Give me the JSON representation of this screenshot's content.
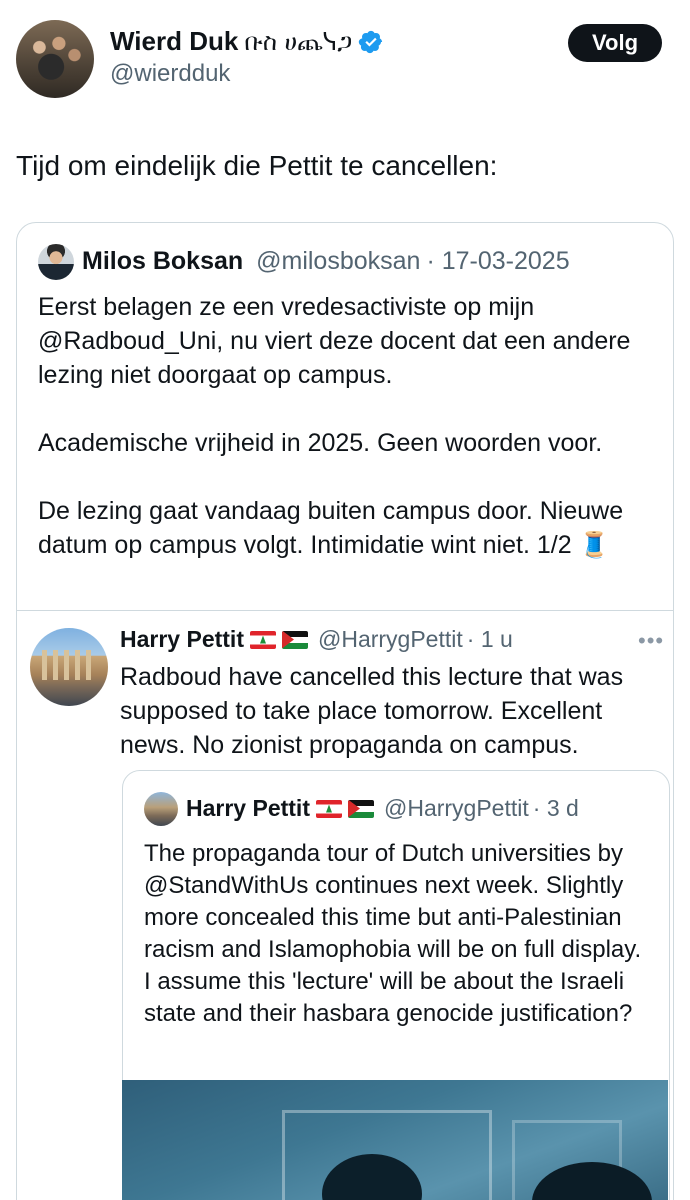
{
  "post": {
    "author_name": "Wierd Duk",
    "author_name_script": "ቡስ ሀጨᓭጋ",
    "author_handle": "@wierdduk",
    "follow_label": "Volg",
    "text": "Tijd om eindelijk die Pettit te cancellen:"
  },
  "quote": {
    "author_name": "Milos Boksan",
    "author_handle": "@milosboksan",
    "date": "· 17-03-2025",
    "text": "Eerst belagen ze een vredesactiviste op mijn @Radboud_Uni, nu viert deze docent dat een andere lezing niet doorgaat op campus.\n\nAcademische vrijheid in 2025. Geen woorden voor.\n\nDe lezing gaat vandaag buiten campus door. Nieuwe datum op campus volgt. Intimidatie wint niet. 1/2 🧵"
  },
  "reply": {
    "author_name": "Harry Pettit",
    "author_handle": "@HarrygPettit",
    "time": "· 1 u",
    "text": "Radboud have cancelled this  lecture that was supposed to take place tomorrow. Excellent news. No zionist propaganda on campus."
  },
  "nested_quote": {
    "author_name": "Harry Pettit",
    "author_handle": "@HarrygPettit",
    "time": "· 3 d",
    "text": "The propaganda tour of Dutch universities by @StandWithUs continues next week. Slightly more concealed this time but anti-Palestinian racism and Islamophobia will be on full display. I assume this 'lecture' will be about the Israeli state and their hasbara genocide justification?"
  },
  "icons": {
    "verified": "verified-badge-icon",
    "more": "more-options-icon",
    "flags": [
      "lebanon-flag-icon",
      "palestine-flag-icon"
    ]
  },
  "colors": {
    "text": "#0f1419",
    "muted": "#536471",
    "border": "#cfd9de",
    "verified": "#1d9bf0",
    "button": "#0f1419"
  }
}
